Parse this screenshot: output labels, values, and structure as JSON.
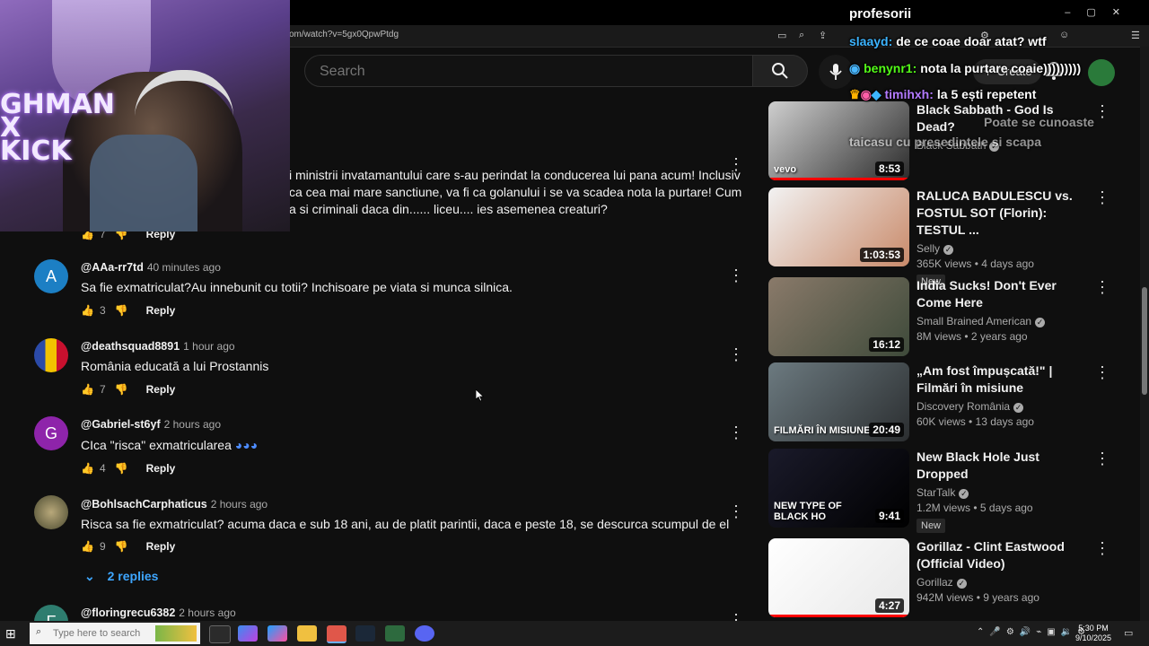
{
  "browser": {
    "url": "om/watch?v=5gx0QpwPtdg",
    "window_controls": [
      "–",
      "▢",
      "✕"
    ]
  },
  "header": {
    "search_placeholder": "Search",
    "create_label": "Create",
    "notification_count": ""
  },
  "overlay": {
    "webcam_logo": "GHMAN\nX\nKICK",
    "chat": [
      {
        "user": "",
        "message": "profesorii",
        "color": "#ffffff"
      },
      {
        "user": "slaayd:",
        "message": "de ce coae doar atat? wtf",
        "color": "#3cb4ff"
      },
      {
        "user": "benynr1:",
        "message": "nota la purtare coaie)))))))))",
        "color": "#53fc18"
      },
      {
        "user": "timihxh:",
        "message": "la 5 ești repetent",
        "color": "#b27aff"
      },
      {
        "user": "",
        "message": "Poate se cunoaste",
        "color": "#ff6a6a"
      },
      {
        "user": "",
        "message": "taicasu cu presedintele si scapa",
        "color": "#ffffff"
      }
    ]
  },
  "comments": [
    {
      "author": "",
      "time": "",
      "lines": [
        "i ministrii invatamantului care s-au perindat la conducerea lui pana acum! Inclusiv",
        "ca cea mai mare sanctiune, va fi ca golanului i se va scadea nota la purtare! Cum",
        "a si criminali daca din...... liceu.... ies asemenea creaturi?"
      ],
      "likes": "7",
      "reply_label": "Reply"
    },
    {
      "author": "@AAa-rr7td",
      "time": "40 minutes ago",
      "avatar_letter": "A",
      "avatar_color": "#1c7fc4",
      "text": "Sa fie exmatriculat?Au innebunit cu totii? Inchisoare pe viata si munca silnica.",
      "likes": "3",
      "reply_label": "Reply"
    },
    {
      "author": "@deathsquad8891",
      "time": "1 hour ago",
      "avatar_letter": "",
      "avatar_color": "#2b4aa8",
      "text": "România educată a lui Prostannis",
      "likes": "7",
      "reply_label": "Reply"
    },
    {
      "author": "@Gabriel-st6yf",
      "time": "2 hours ago",
      "avatar_letter": "G",
      "avatar_color": "#8e24aa",
      "text": "CIca \"risca\" exmatricularea",
      "likes": "4",
      "reply_label": "Reply"
    },
    {
      "author": "@BohlsachCarphaticus",
      "time": "2 hours ago",
      "avatar_letter": "",
      "avatar_color": "#6b6b4a",
      "text": "Risca sa fie exmatriculat? acuma daca e sub 18 ani, au de platit parintii, daca e peste 18, se descurca scumpul de el",
      "likes": "9",
      "reply_label": "Reply",
      "replies_label": "2 replies"
    },
    {
      "author": "@floringrecu6382",
      "time": "2 hours ago",
      "avatar_letter": "F",
      "avatar_color": "#2e7d6f"
    }
  ],
  "recommendations": [
    {
      "title": "Black Sabbath - God Is Dead?",
      "channel": "Black Sabbath",
      "meta": "",
      "duration": "8:53",
      "new": false,
      "progress": 1.0,
      "thumb_colors": [
        "#cfcfcf",
        "#2b2b2b"
      ],
      "thumb_label": "vevo"
    },
    {
      "title": "RALUCA BADULESCU vs. FOSTUL SOT (Florin): TESTUL ...",
      "channel": "Selly",
      "meta": "365K views • 4 days ago",
      "duration": "1:03:53",
      "new": true,
      "new_label": "New",
      "progress": 0,
      "thumb_colors": [
        "#f2f2f2",
        "#c98a6a"
      ]
    },
    {
      "title": "India Sucks! Don't Ever Come Here",
      "channel": "Small Brained American",
      "meta": "8M views • 2 years ago",
      "duration": "16:12",
      "new": false,
      "progress": 0,
      "thumb_colors": [
        "#8a7a6a",
        "#3e4a3a"
      ]
    },
    {
      "title": "„Am fost împușcată!\" | Filmări în misiune",
      "channel": "Discovery România",
      "meta": "60K views • 13 days ago",
      "duration": "20:49",
      "new": false,
      "progress": 0,
      "thumb_colors": [
        "#6c7a80",
        "#2b2e30"
      ],
      "thumb_label": "FILMĂRI ÎN MISIUNE"
    },
    {
      "title": "New Black Hole Just Dropped",
      "channel": "StarTalk",
      "meta": "1.2M views • 5 days ago",
      "duration": "9:41",
      "new": true,
      "new_label": "New",
      "progress": 0,
      "thumb_colors": [
        "#1a1a2a",
        "#000000"
      ],
      "thumb_label": "NEW TYPE OF BLACK HO"
    },
    {
      "title": "Gorillaz - Clint Eastwood (Official Video)",
      "channel": "Gorillaz",
      "meta": "942M views • 9 years ago",
      "duration": "4:27",
      "new": false,
      "progress": 1.0,
      "thumb_colors": [
        "#ffffff",
        "#e8e8e8"
      ]
    }
  ],
  "taskbar": {
    "search_placeholder": "Type here to search",
    "time": "5:30 PM",
    "date": "9/10/2025"
  }
}
